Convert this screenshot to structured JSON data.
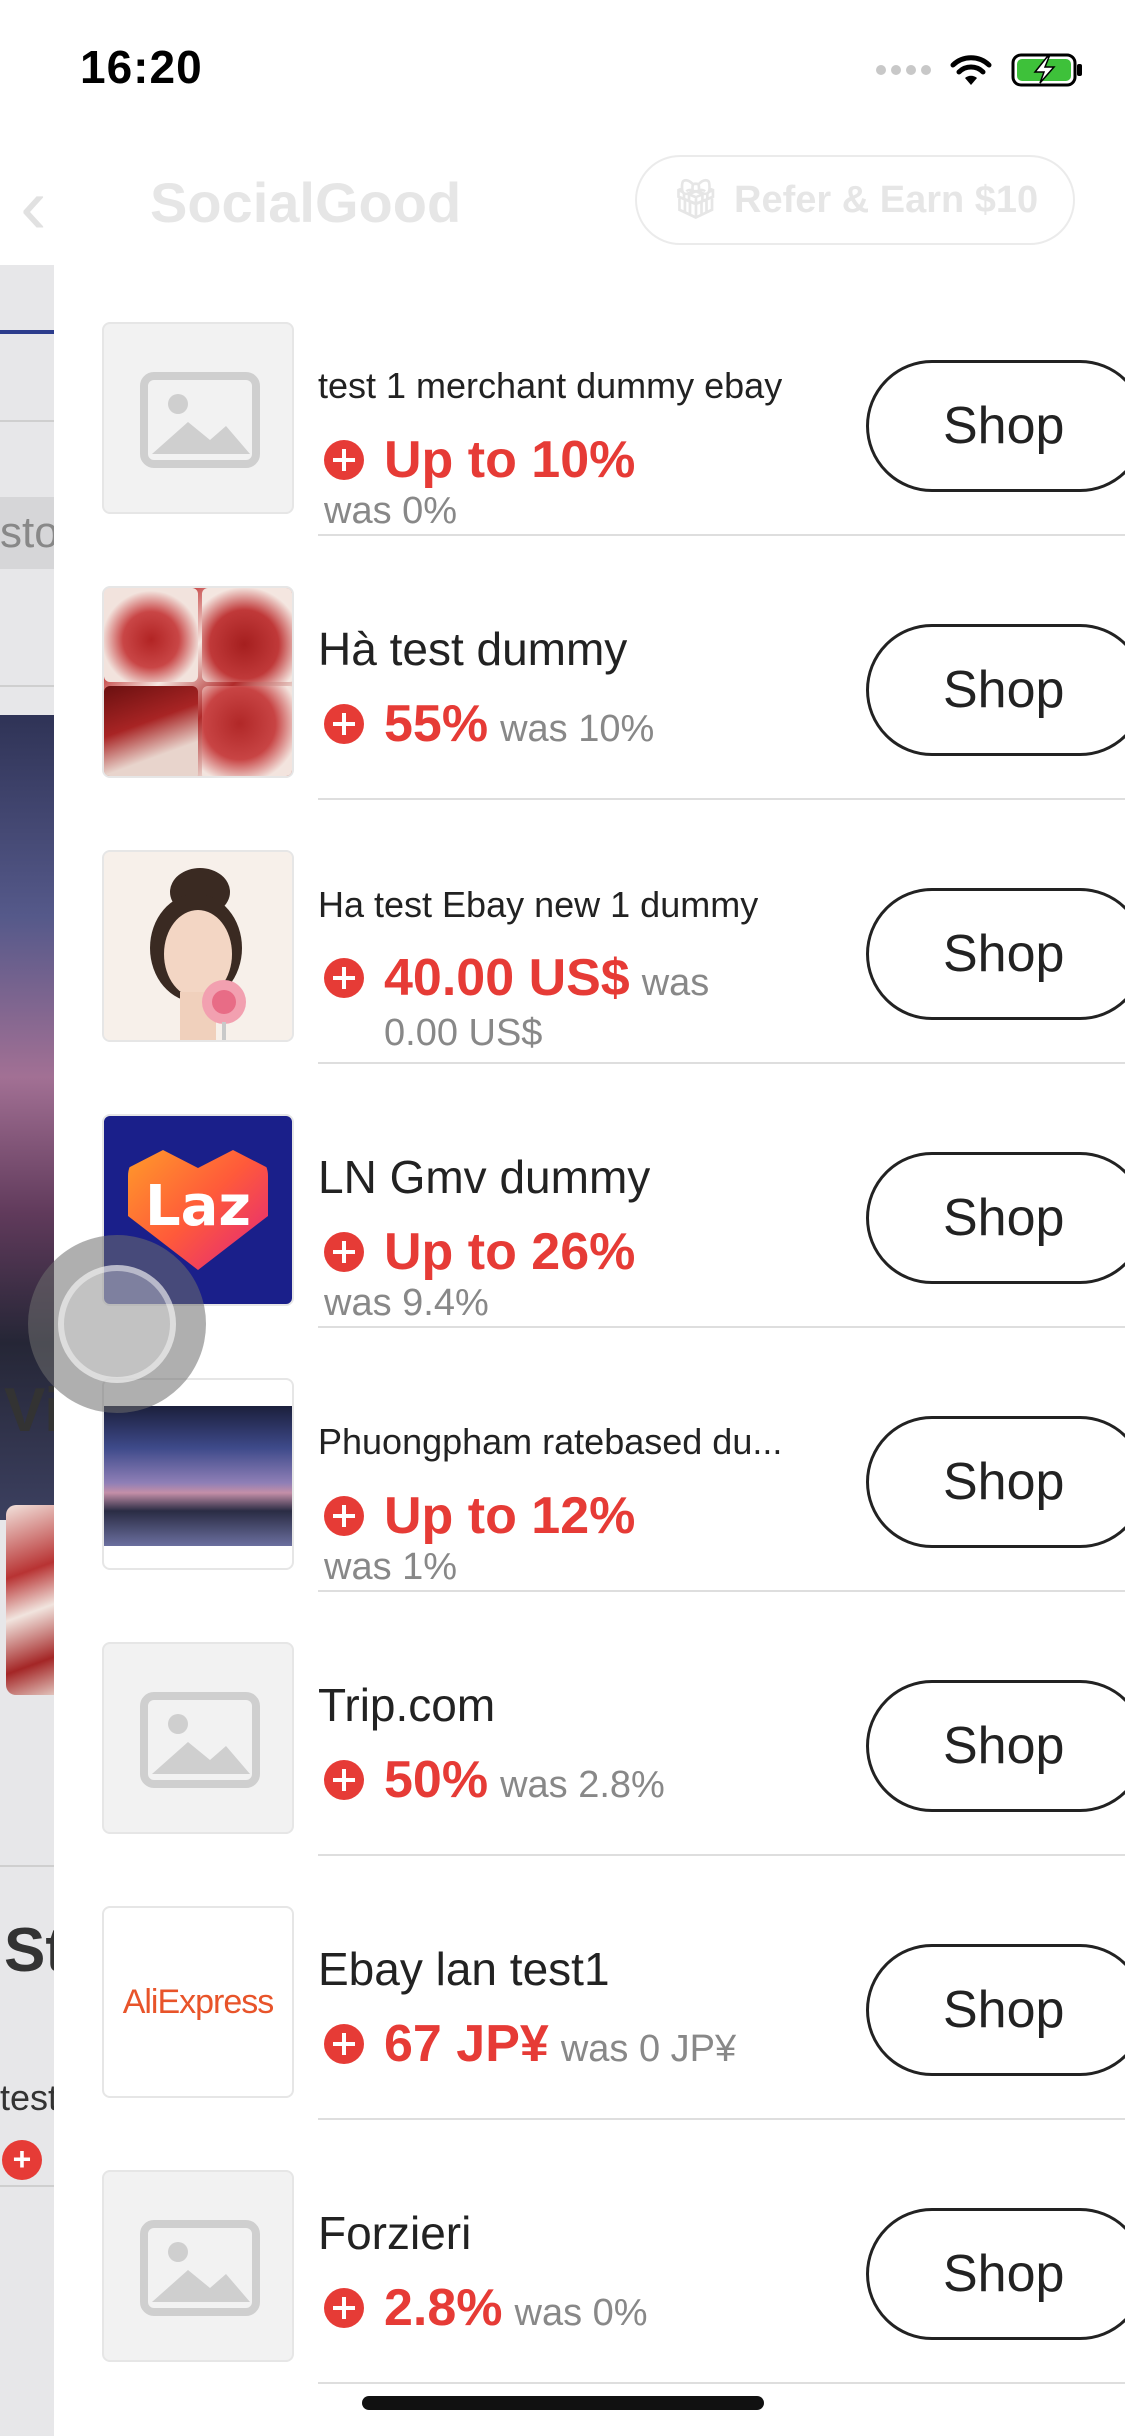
{
  "status_bar": {
    "time": "16:20"
  },
  "background_header": {
    "logo_text": "SocialGood",
    "refer_label": "Refer & Earn $10"
  },
  "background_page": {
    "search_fragment": "sto",
    "section_heading_1": "Vi",
    "section_heading_2": "St",
    "small_text": "test"
  },
  "merchants": [
    {
      "name": "test 1 merchant dummy ebay",
      "rate": "Up to 10%",
      "was": "was 0%",
      "logo": "placeholder-image-icon"
    },
    {
      "name": "Hà test dummy",
      "rate": "55%",
      "was": "was 10%",
      "logo": "lipstick-product-image"
    },
    {
      "name": "Ha test Ebay new 1 dummy",
      "rate": "40.00 US$",
      "was": "was",
      "was_extra": "0.00 US$",
      "logo": "portrait-image"
    },
    {
      "name": "LN Gmv dummy",
      "rate": "Up to 26%",
      "was": "was 9.4%",
      "logo": "lazada-logo",
      "logo_text": "Laz"
    },
    {
      "name": "Phuongpham ratebased du...",
      "rate": "Up to 12%",
      "was": "was 1%",
      "logo": "lake-sunset-image"
    },
    {
      "name": "Trip.com",
      "rate": "50%",
      "was": "was 2.8%",
      "logo": "placeholder-image-icon"
    },
    {
      "name": "Ebay lan test1",
      "rate": "67 JP¥",
      "was": "was 0 JP¥",
      "logo": "aliexpress-logo",
      "logo_text": "AliExpress"
    },
    {
      "name": "Forzieri",
      "rate": "2.8%",
      "was": "was 0%",
      "logo": "placeholder-image-icon"
    }
  ],
  "shop_label": "Shop",
  "colors": {
    "accent_red": "#e63b36",
    "text_dark": "#222222",
    "text_muted": "#888888",
    "divider": "#dedede"
  }
}
